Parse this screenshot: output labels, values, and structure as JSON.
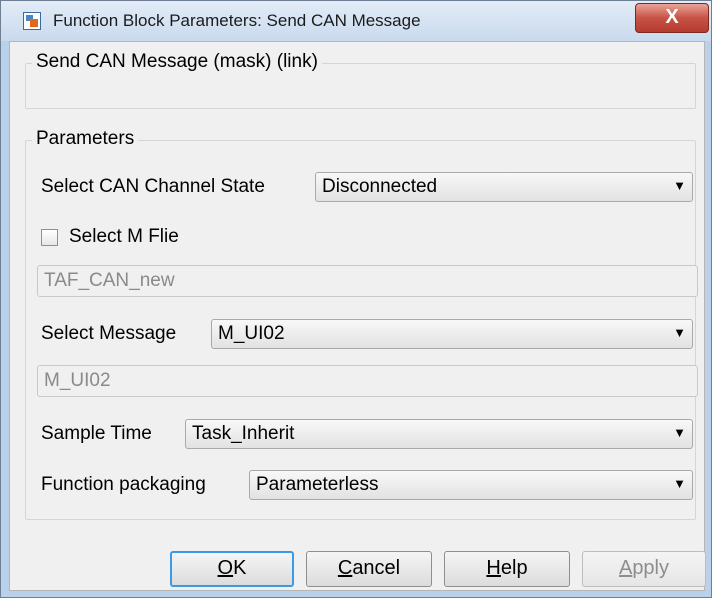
{
  "window": {
    "title": "Function Block Parameters: Send CAN Message",
    "close_label": "X",
    "icon": "simulink-block-icon"
  },
  "header_group": {
    "title": "Send CAN Message  (mask) (link)"
  },
  "params_group": {
    "title": "Parameters",
    "channel_state": {
      "label": "Select CAN Channel State",
      "value": "Disconnected"
    },
    "select_m_file": {
      "label": "Select M Flie",
      "checked": false
    },
    "m_file_field": {
      "value": "TAF_CAN_new"
    },
    "select_message": {
      "label": "Select Message",
      "value": "M_UI02"
    },
    "message_field": {
      "value": "M_UI02"
    },
    "sample_time": {
      "label": "Sample Time",
      "value": "Task_Inherit"
    },
    "function_packaging": {
      "label": "Function packaging",
      "value": "Parameterless"
    }
  },
  "buttons": {
    "ok": {
      "mnemonic": "O",
      "rest": "K"
    },
    "cancel": {
      "mnemonic": "C",
      "rest": "ancel"
    },
    "help": {
      "mnemonic": "H",
      "rest": "elp"
    },
    "apply": {
      "mnemonic": "A",
      "rest": "pply"
    }
  }
}
